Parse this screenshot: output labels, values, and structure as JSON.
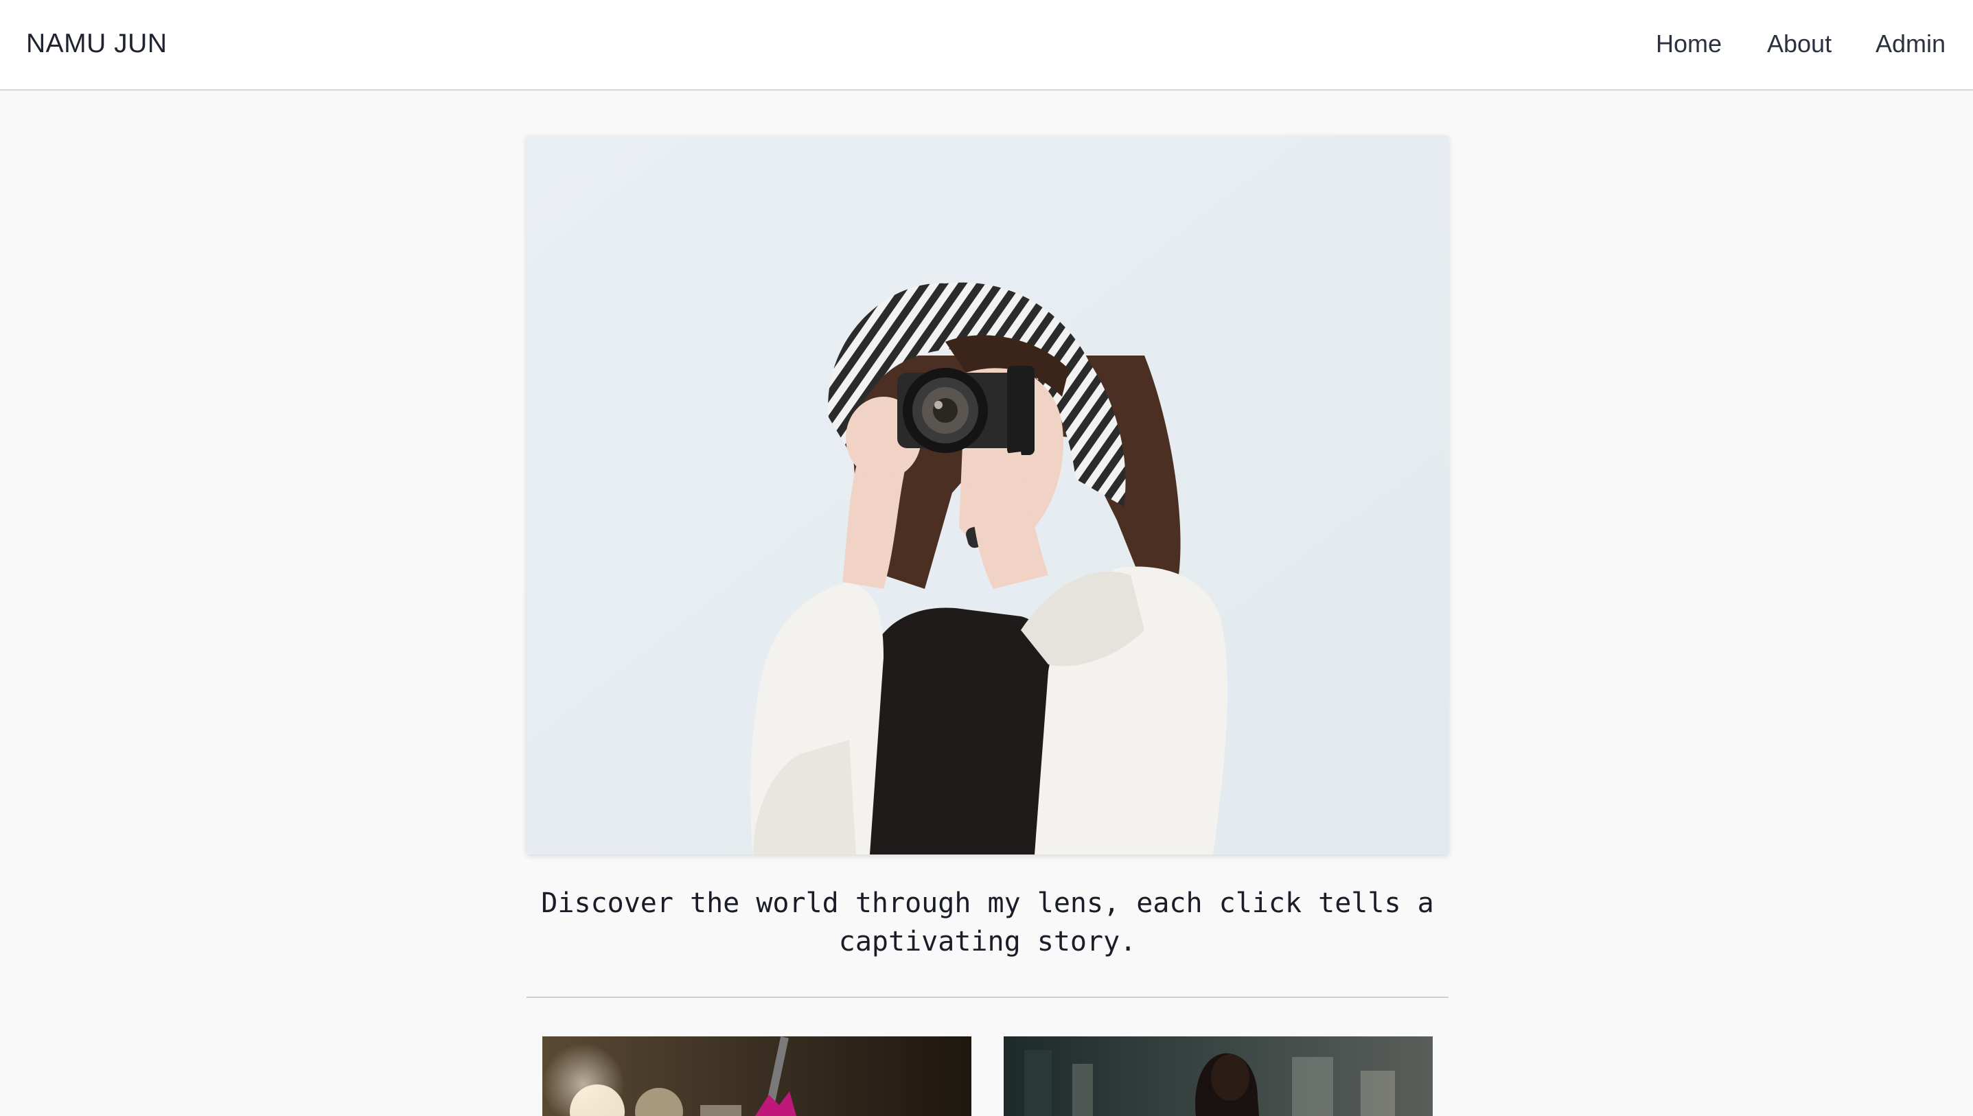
{
  "brand": {
    "name": "NAMU JUN"
  },
  "nav": {
    "home": "Home",
    "about": "About",
    "admin": "Admin"
  },
  "hero": {
    "tagline": "Discover the world through my lens, each click tells a captivating story."
  },
  "gallery": {
    "thumbnails": [
      {
        "subject": "street-flower-photo"
      },
      {
        "subject": "street-portrait-photo"
      }
    ]
  },
  "colors": {
    "page_bg": "#f9f9f9",
    "nav_bg": "#ffffff",
    "text": "#1f2330",
    "hero_sky": "#e8eef2"
  }
}
